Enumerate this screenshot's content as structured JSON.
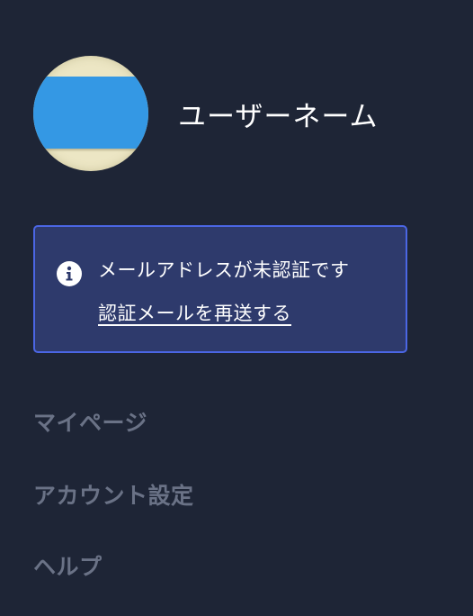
{
  "profile": {
    "username": "ユーザーネーム",
    "avatar_colors": {
      "background": "#ece6c4",
      "band": "#3498e4"
    }
  },
  "email_notice": {
    "icon": "info-icon",
    "message": "メールアドレスが未認証です",
    "resend_link": "認証メールを再送する",
    "colors": {
      "background": "#2e3a6c",
      "border": "#4b66e4"
    }
  },
  "menu": {
    "items": [
      {
        "label": "マイページ"
      },
      {
        "label": "アカウント設定"
      },
      {
        "label": "ヘルプ"
      }
    ]
  },
  "colors": {
    "page_background": "#1e2536",
    "menu_text": "#6a7286",
    "text": "#ffffff"
  }
}
